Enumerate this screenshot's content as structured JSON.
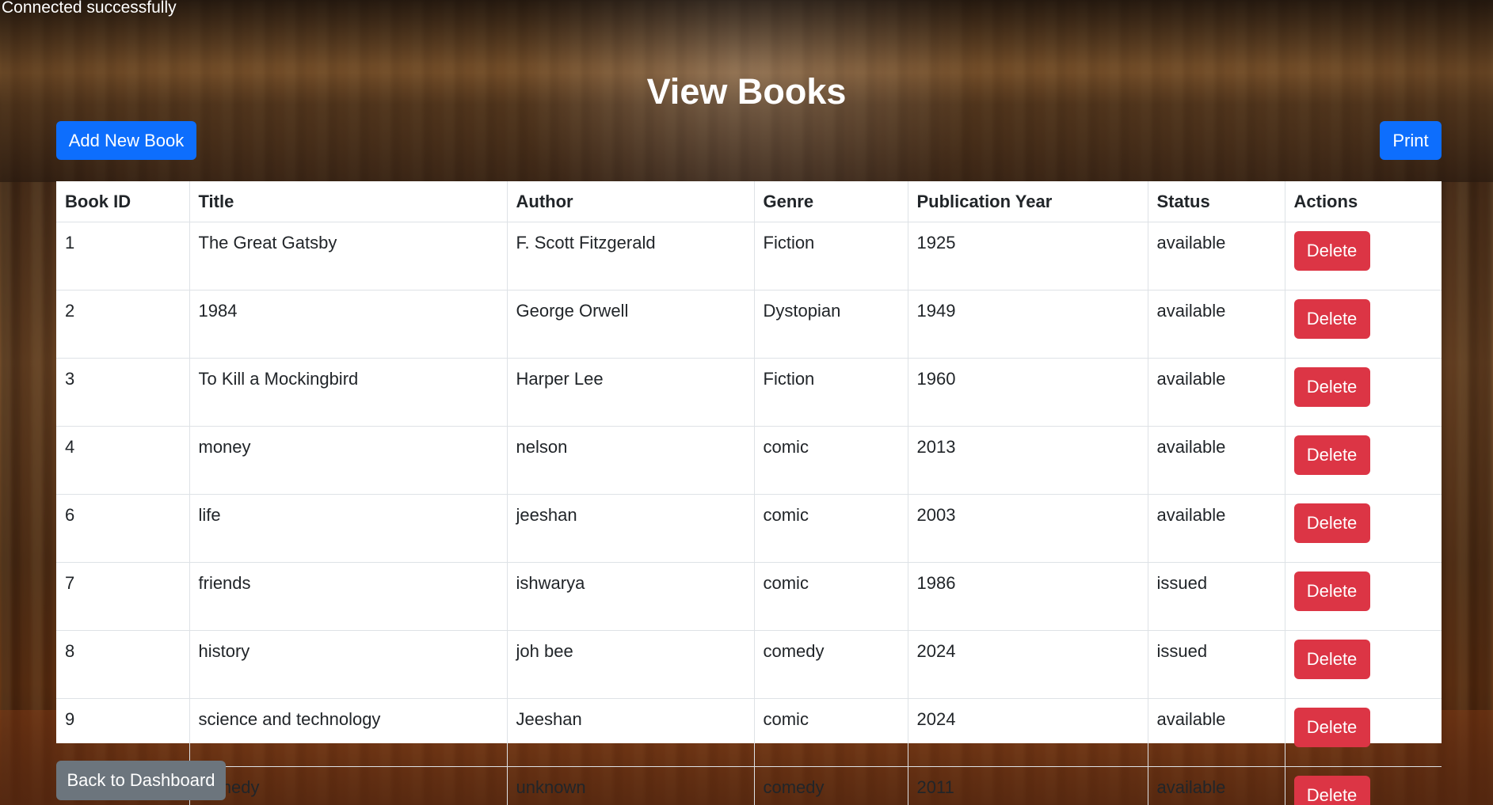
{
  "status_message": "Connected successfully",
  "page_title": "View Books",
  "toolbar": {
    "add_label": "Add New Book",
    "print_label": "Print"
  },
  "table": {
    "headers": [
      "Book ID",
      "Title",
      "Author",
      "Genre",
      "Publication Year",
      "Status",
      "Actions"
    ],
    "rows": [
      {
        "id": "1",
        "title": "The Great Gatsby",
        "author": "F. Scott Fitzgerald",
        "genre": "Fiction",
        "year": "1925",
        "status": "available",
        "action": "Delete"
      },
      {
        "id": "2",
        "title": "1984",
        "author": "George Orwell",
        "genre": "Dystopian",
        "year": "1949",
        "status": "available",
        "action": "Delete"
      },
      {
        "id": "3",
        "title": "To Kill a Mockingbird",
        "author": "Harper Lee",
        "genre": "Fiction",
        "year": "1960",
        "status": "available",
        "action": "Delete"
      },
      {
        "id": "4",
        "title": "money",
        "author": "nelson",
        "genre": "comic",
        "year": "2013",
        "status": "available",
        "action": "Delete"
      },
      {
        "id": "6",
        "title": "life",
        "author": "jeeshan",
        "genre": "comic",
        "year": "2003",
        "status": "available",
        "action": "Delete"
      },
      {
        "id": "7",
        "title": "friends",
        "author": "ishwarya",
        "genre": "comic",
        "year": "1986",
        "status": "issued",
        "action": "Delete"
      },
      {
        "id": "8",
        "title": "history",
        "author": "joh bee",
        "genre": "comedy",
        "year": "2024",
        "status": "issued",
        "action": "Delete"
      },
      {
        "id": "9",
        "title": "science and technology",
        "author": "Jeeshan",
        "genre": "comic",
        "year": "2024",
        "status": "available",
        "action": "Delete"
      },
      {
        "id": "10",
        "title": "comedy",
        "author": "unknown",
        "genre": "comedy",
        "year": "2011",
        "status": "available",
        "action": "Delete"
      }
    ]
  },
  "footer": {
    "back_label": "Back to Dashboard"
  },
  "colors": {
    "primary": "#0d6efd",
    "danger": "#dc3545",
    "secondary": "#6c757d"
  }
}
